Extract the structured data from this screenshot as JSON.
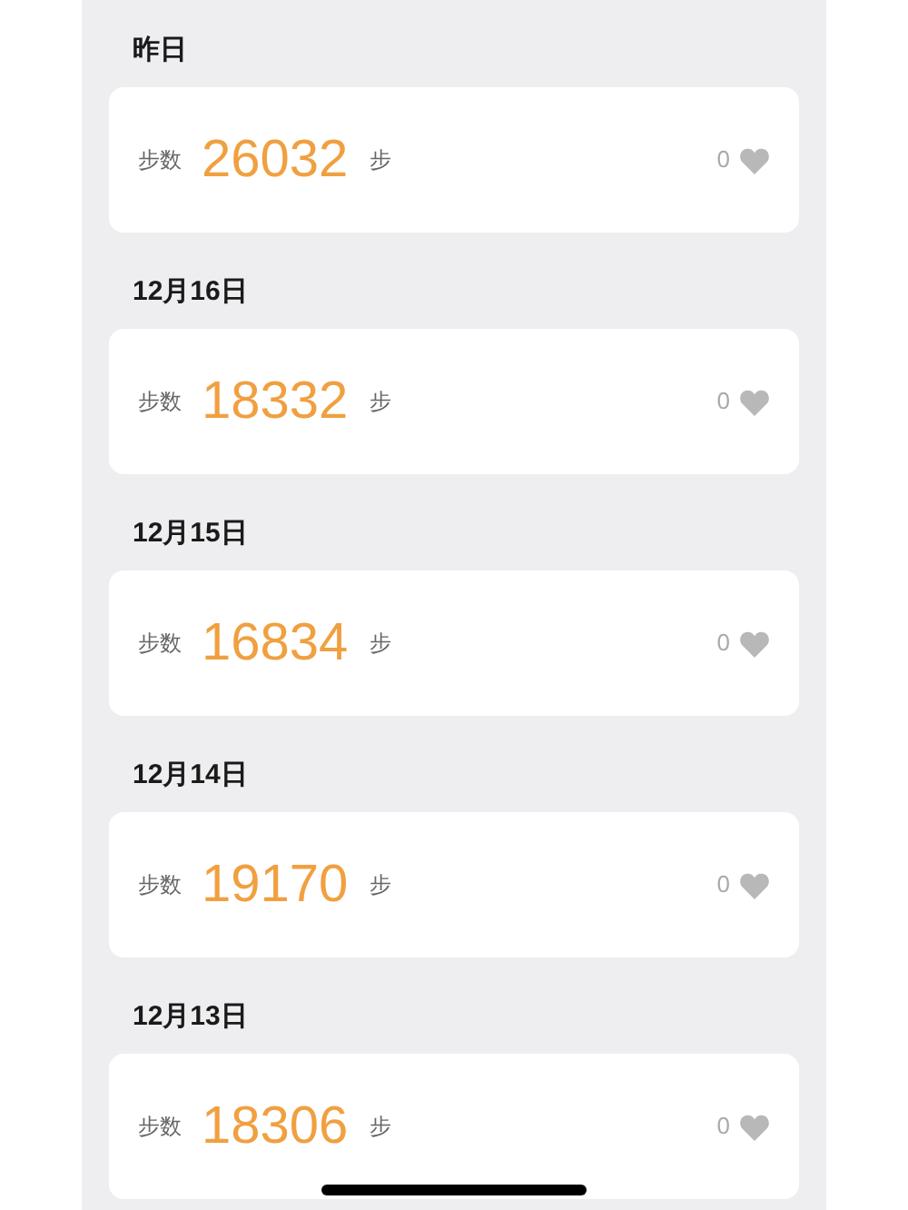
{
  "days": [
    {
      "date": "昨日",
      "label": "步数",
      "steps": "26032",
      "unit": "步",
      "likes": "0",
      "liked": false
    },
    {
      "date": "12月16日",
      "label": "步数",
      "steps": "18332",
      "unit": "步",
      "likes": "0",
      "liked": false
    },
    {
      "date": "12月15日",
      "label": "步数",
      "steps": "16834",
      "unit": "步",
      "likes": "0",
      "liked": false
    },
    {
      "date": "12月14日",
      "label": "步数",
      "steps": "19170",
      "unit": "步",
      "likes": "0",
      "liked": false
    },
    {
      "date": "12月13日",
      "label": "步数",
      "steps": "18306",
      "unit": "步",
      "likes": "0",
      "liked": false
    }
  ]
}
